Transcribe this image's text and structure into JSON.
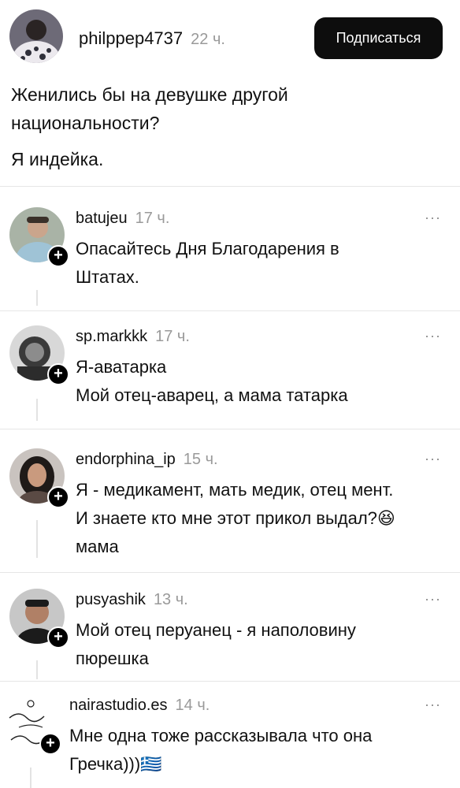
{
  "post": {
    "username": "philppep4737",
    "time": "22 ч.",
    "follow_label": "Подписаться",
    "text_line1": "Женились бы на девушке другой",
    "text_line2": "национальности?",
    "text_line3": "Я индейка."
  },
  "comments": [
    {
      "username": "batujeu",
      "time": "17 ч.",
      "line1": "Опасайтесь Дня Благодарения в",
      "line2": "Штатах.",
      "line3": ""
    },
    {
      "username": "sp.markkk",
      "time": "17 ч.",
      "line1": "Я-аватарка",
      "line2": "Мой отец-аварец, а мама татарка",
      "line3": ""
    },
    {
      "username": "endorphina_ip",
      "time": "15 ч.",
      "line1": "Я - медикамент, мать медик, отец мент.",
      "line2": "И знаете кто мне этот прикол выдал?😆",
      "line3": "мама"
    },
    {
      "username": "pusyashik",
      "time": "13 ч.",
      "line1": "Мой отец перуанец - я наполовину",
      "line2": "пюрешка",
      "line3": ""
    },
    {
      "username": "nairastudio.es",
      "time": "14 ч.",
      "line1": "Мне одна тоже рассказывала что она",
      "line2": "Гречка)))🇬🇷",
      "line3": ""
    }
  ],
  "icons": {
    "more": "more-horizontal-icon",
    "plus": "plus-icon"
  },
  "ui": {
    "more_glyph": "···",
    "plus_glyph": "+"
  }
}
